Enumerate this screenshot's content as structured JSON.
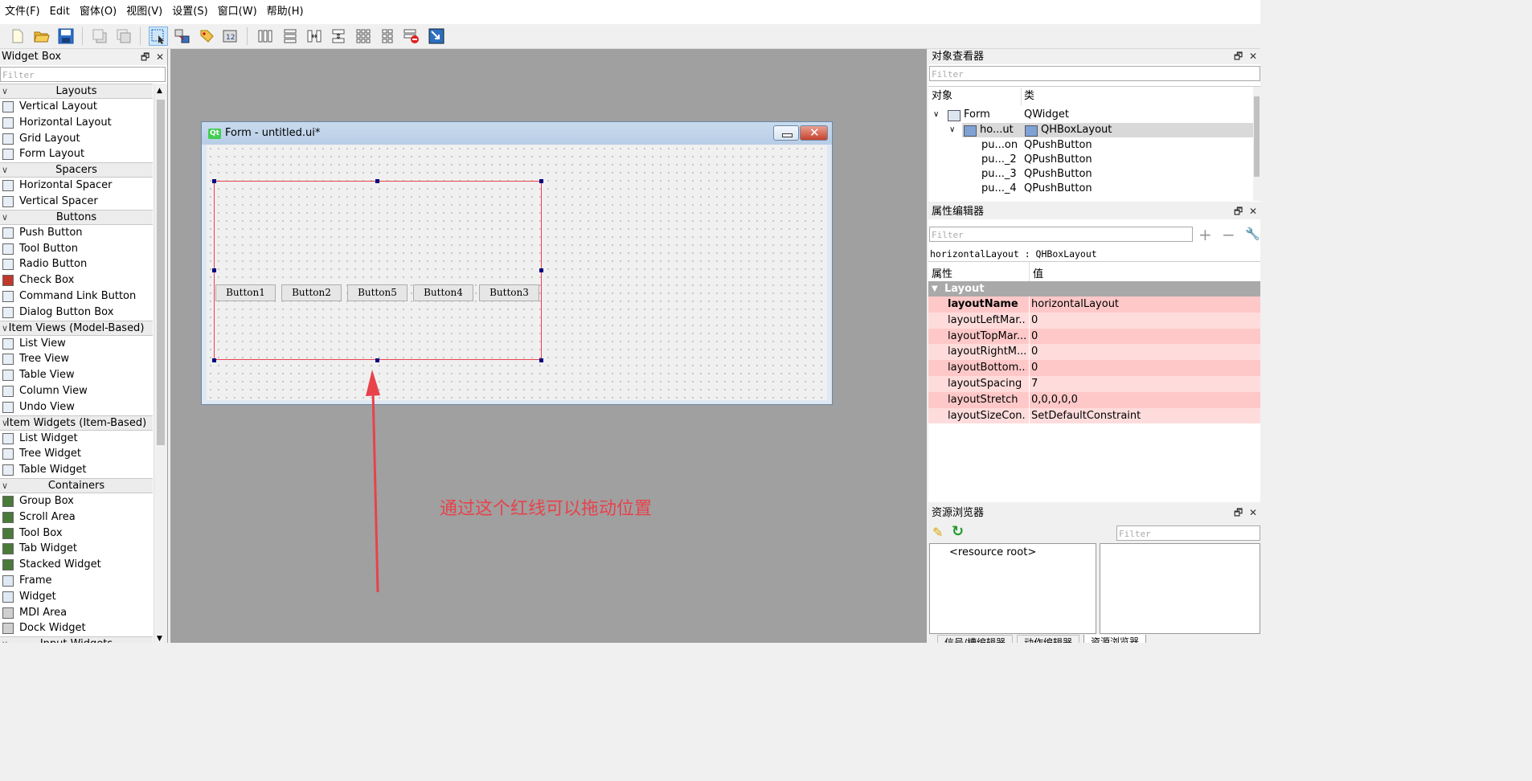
{
  "menu": [
    "文件(F)",
    "Edit",
    "窗体(O)",
    "视图(V)",
    "设置(S)",
    "窗口(W)",
    "帮助(H)"
  ],
  "widget_box": {
    "title": "Widget Box",
    "filter_placeholder": "Filter",
    "categories": [
      {
        "name": "Layouts",
        "items": [
          "Vertical Layout",
          "Horizontal Layout",
          "Grid Layout",
          "Form Layout"
        ]
      },
      {
        "name": "Spacers",
        "items": [
          "Horizontal Spacer",
          "Vertical Spacer"
        ]
      },
      {
        "name": "Buttons",
        "items": [
          "Push Button",
          "Tool Button",
          "Radio Button",
          "Check Box",
          "Command Link Button",
          "Dialog Button Box"
        ]
      },
      {
        "name": "Item Views (Model-Based)",
        "items": [
          "List View",
          "Tree View",
          "Table View",
          "Column View",
          "Undo View"
        ]
      },
      {
        "name": "Item Widgets (Item-Based)",
        "items": [
          "List Widget",
          "Tree Widget",
          "Table Widget"
        ]
      },
      {
        "name": "Containers",
        "items": [
          "Group Box",
          "Scroll Area",
          "Tool Box",
          "Tab Widget",
          "Stacked Widget",
          "Frame",
          "Widget",
          "MDI Area",
          "Dock Widget"
        ]
      },
      {
        "name": "Input Widgets",
        "items": []
      }
    ]
  },
  "form": {
    "title": "Form - untitled.ui*",
    "qt_badge": "Qt",
    "buttons": [
      "Button1",
      "Button2",
      "Button5",
      "Button4",
      "Button3"
    ]
  },
  "annotation": "通过这个红线可以拖动位置",
  "object_inspector": {
    "title": "对象查看器",
    "filter_placeholder": "Filter",
    "col_object": "对象",
    "col_class": "类",
    "rows": [
      {
        "object": "Form",
        "class": "QWidget"
      },
      {
        "object": "ho...ut",
        "class": "QHBoxLayout"
      },
      {
        "object": "pu...on",
        "class": "QPushButton"
      },
      {
        "object": "pu..._2",
        "class": "QPushButton"
      },
      {
        "object": "pu..._3",
        "class": "QPushButton"
      },
      {
        "object": "pu..._4",
        "class": "QPushButton"
      }
    ]
  },
  "property_editor": {
    "title": "属性编辑器",
    "filter_placeholder": "Filter",
    "object_label": "horizontalLayout : QHBoxLayout",
    "col_property": "属性",
    "col_value": "值",
    "group": "Layout",
    "rows": [
      {
        "name": "layoutName",
        "value": "horizontalLayout"
      },
      {
        "name": "layoutLeftMar...",
        "value": "0"
      },
      {
        "name": "layoutTopMar...",
        "value": "0"
      },
      {
        "name": "layoutRightM...",
        "value": "0"
      },
      {
        "name": "layoutBottom...",
        "value": "0"
      },
      {
        "name": "layoutSpacing",
        "value": "7"
      },
      {
        "name": "layoutStretch",
        "value": "0,0,0,0,0"
      },
      {
        "name": "layoutSizeCon...",
        "value": "SetDefaultConstraint"
      }
    ]
  },
  "resource_browser": {
    "title": "资源浏览器",
    "filter_placeholder": "Filter",
    "root": "<resource root>",
    "tabs": [
      "信号/槽编辑器",
      "动作编辑器",
      "资源浏览器"
    ]
  },
  "colors": {
    "selection_red": "#e8424b",
    "prop_row_a": "#ffc8c8",
    "prop_row_b": "#ffdcdc",
    "handle": "#000080"
  }
}
